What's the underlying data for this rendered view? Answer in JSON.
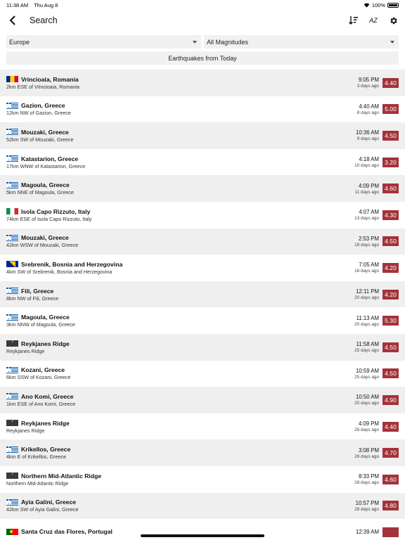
{
  "status_bar": {
    "time": "11:38 AM",
    "date": "Thu Aug 8",
    "battery": "100%"
  },
  "header": {
    "title": "Search",
    "back_icon": "chevron-left-icon",
    "sort_icon": "sort-descending-icon",
    "az_label": "AZ",
    "settings_icon": "gear-icon"
  },
  "filters": {
    "region": "Europe",
    "magnitude": "All Magnitudes"
  },
  "today_button": "Earthquakes from Today",
  "colors": {
    "magnitude_badge": "#a3333a",
    "row_alt": "#efefef"
  },
  "quakes": [
    {
      "flag": "ro",
      "title": "Vrincioaia, Romania",
      "subtitle": "2km ESE of Vrincioaia, Romania",
      "time": "9:05 PM",
      "ago": "3 days ago",
      "mag": "4.40"
    },
    {
      "flag": "gr",
      "title": "Gazion, Greece",
      "subtitle": "12km NW of Gazion, Greece",
      "time": "4:40 AM",
      "ago": "8 days ago",
      "mag": "5.00"
    },
    {
      "flag": "gr",
      "title": "Mouzaki, Greece",
      "subtitle": "52km SW of Mouzaki, Greece",
      "time": "10:36 AM",
      "ago": "9 days ago",
      "mag": "4.50"
    },
    {
      "flag": "gr",
      "title": "Katastarion, Greece",
      "subtitle": "17km WNW of Katastarion, Greece",
      "time": "4:18 AM",
      "ago": "10 days ago",
      "mag": "3.20"
    },
    {
      "flag": "gr",
      "title": "Magoula, Greece",
      "subtitle": "5km NNE of Magoula, Greece",
      "time": "4:09 PM",
      "ago": "11 days ago",
      "mag": "4.60"
    },
    {
      "flag": "it",
      "title": "Isola Capo Rizzuto, Italy",
      "subtitle": "74km ESE of Isola Capo Rizzuto, Italy",
      "time": "4:07 AM",
      "ago": "13 days ago",
      "mag": "4.30"
    },
    {
      "flag": "gr",
      "title": "Mouzaki, Greece",
      "subtitle": "42km WSW of Mouzaki, Greece",
      "time": "2:53 PM",
      "ago": "18 days ago",
      "mag": "4.50"
    },
    {
      "flag": "ba",
      "title": "Srebrenik, Bosnia and Herzegovina",
      "subtitle": "4km SW of Srebrenik, Bosnia and Herzegovina",
      "time": "7:05 AM",
      "ago": "18 days ago",
      "mag": "4.20"
    },
    {
      "flag": "gr",
      "title": "Fili, Greece",
      "subtitle": "8km NW of Fili, Greece",
      "time": "12:11 PM",
      "ago": "20 days ago",
      "mag": "4.20"
    },
    {
      "flag": "gr",
      "title": "Magoula, Greece",
      "subtitle": "3km NNW of Magoula, Greece",
      "time": "11:13 AM",
      "ago": "20 days ago",
      "mag": "5.30"
    },
    {
      "flag": "na",
      "title": "Reykjanes Ridge",
      "subtitle": "Reykjanes Ridge",
      "time": "11:58 AM",
      "ago": "25 days ago",
      "mag": "4.50"
    },
    {
      "flag": "gr",
      "title": "Kozani, Greece",
      "subtitle": "6km SSW of Kozani, Greece",
      "time": "10:59 AM",
      "ago": "25 days ago",
      "mag": "4.50"
    },
    {
      "flag": "gr",
      "title": "Ano Komi, Greece",
      "subtitle": "1km ESE of Ano Komi, Greece",
      "time": "10:50 AM",
      "ago": "25 days ago",
      "mag": "4.90"
    },
    {
      "flag": "na",
      "title": "Reykjanes Ridge",
      "subtitle": "Reykjanes Ridge",
      "time": "4:09 PM",
      "ago": "26 days ago",
      "mag": "4.40"
    },
    {
      "flag": "gr",
      "title": "Krikellos, Greece",
      "subtitle": "4km E of Krikellos, Greece",
      "time": "3:08 PM",
      "ago": "26 days ago",
      "mag": "4.70"
    },
    {
      "flag": "na",
      "title": "Northern Mid-Atlantic Ridge",
      "subtitle": "Northern Mid-Atlantic Ridge",
      "time": "8:33 PM",
      "ago": "28 days ago",
      "mag": "4.60"
    },
    {
      "flag": "gr",
      "title": "Ayia Galini, Greece",
      "subtitle": "42km SW of Ayia Galini, Greece",
      "time": "10:57 PM",
      "ago": "28 days ago",
      "mag": "4.80"
    },
    {
      "flag": "pt",
      "title": "Santa Cruz das Flores, Portugal",
      "subtitle": "",
      "time": "12:39 AM",
      "ago": "",
      "mag": ""
    }
  ]
}
